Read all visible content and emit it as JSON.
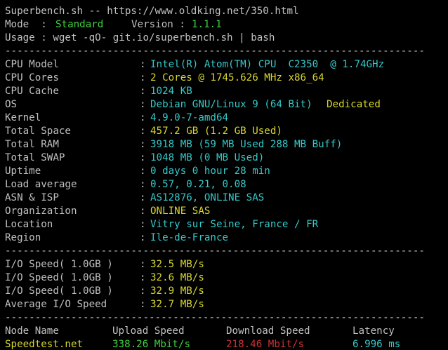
{
  "header": {
    "title": "Superbench.sh -- https://www.oldking.net/350.html",
    "mode_label": "Mode  : ",
    "mode_value": "Standard",
    "version_label": "Version : ",
    "version_value": "1.1.1",
    "usage": "Usage : wget -qO- git.io/superbench.sh | bash"
  },
  "separator": "----------------------------------------------------------------------",
  "system_info": [
    {
      "label": "CPU Model",
      "value": "Intel(R) Atom(TM) CPU  C2350  @ 1.74GHz"
    },
    {
      "label": "CPU Cores",
      "value": "2 Cores @ 1745.626 MHz x86_64"
    },
    {
      "label": "CPU Cache",
      "value": "1024 KB"
    },
    {
      "label": "OS",
      "value": "Debian GNU/Linux 9 (64 Bit)",
      "extra": "Dedicated"
    },
    {
      "label": "Kernel",
      "value": "4.9.0-7-amd64"
    },
    {
      "label": "Total Space",
      "value": "457.2 GB (1.2 GB Used)"
    },
    {
      "label": "Total RAM",
      "value": "3918 MB (59 MB Used 288 MB Buff)"
    },
    {
      "label": "Total SWAP",
      "value": "1048 MB (0 MB Used)"
    },
    {
      "label": "Uptime",
      "value": "0 days 0 hour 28 min"
    },
    {
      "label": "Load average",
      "value": "0.57, 0.21, 0.08"
    },
    {
      "label": "ASN & ISP",
      "value": "AS12876, ONLINE SAS"
    },
    {
      "label": "Organization",
      "value": "ONLINE SAS"
    },
    {
      "label": "Location",
      "value": "Vitry sur Seine, France / FR"
    },
    {
      "label": "Region",
      "value": "Ile-de-France"
    }
  ],
  "io_speed": [
    {
      "label": "I/O Speed( 1.0GB )",
      "value": "32.5 MB/s"
    },
    {
      "label": "I/O Speed( 1.0GB )",
      "value": "32.6 MB/s"
    },
    {
      "label": "I/O Speed( 1.0GB )",
      "value": "32.9 MB/s"
    },
    {
      "label": "Average I/O Speed",
      "value": "32.7 MB/s"
    }
  ],
  "speedtest": {
    "headers": [
      "Node Name",
      "Upload Speed",
      "Download Speed",
      "Latency"
    ],
    "rows": [
      {
        "node": "Speedtest.net",
        "upload": "338.26 Mbit/s",
        "download": "218.46 Mbit/s",
        "latency": "6.996 ms"
      }
    ]
  },
  "colors": {
    "background": "#000000",
    "text": "#c0c0c0",
    "green": "#3fd13f",
    "cyan": "#35c9c9",
    "yellow": "#d6d630",
    "red": "#cc3333"
  }
}
